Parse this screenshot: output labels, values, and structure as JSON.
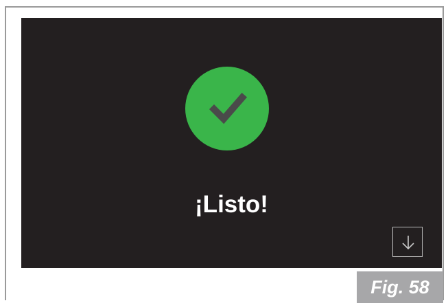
{
  "screen": {
    "status_icon": "checkmark-circle-icon",
    "message": "¡Listo!",
    "next_icon": "arrow-down-icon",
    "colors": {
      "background": "#231f20",
      "success": "#3ab54a",
      "check": "#4a4a4a"
    }
  },
  "figure": {
    "caption": "Fig. 58"
  }
}
